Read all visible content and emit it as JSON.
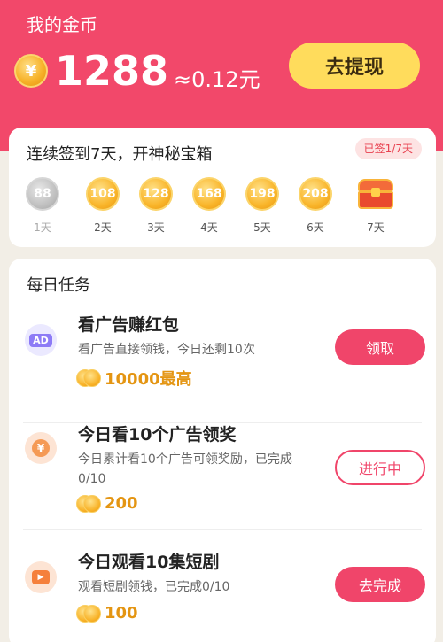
{
  "header": {
    "title": "我的金币",
    "coin_icon": "¥",
    "balance": "1288",
    "approx": "≈0.12元",
    "withdraw_label": "去提现"
  },
  "signin": {
    "title": "连续签到7天，开神秘宝箱",
    "badge": "已签1/7天",
    "days": [
      {
        "coins": "88",
        "label": "1天",
        "done": true
      },
      {
        "coins": "108",
        "label": "2天"
      },
      {
        "coins": "128",
        "label": "3天"
      },
      {
        "coins": "168",
        "label": "4天"
      },
      {
        "coins": "198",
        "label": "5天"
      },
      {
        "coins": "208",
        "label": "6天"
      },
      {
        "icon": "treasure-chest-icon",
        "label": "7天"
      }
    ]
  },
  "tasks": {
    "title": "每日任务",
    "items": [
      {
        "icon": "ad-icon",
        "icon_text": "AD",
        "name": "看广告赚红包",
        "desc": "看广告直接领钱，今日还剩10次",
        "reward": "10000最高",
        "button": "领取"
      },
      {
        "icon": "yen-coin-icon",
        "icon_text": "¥",
        "name": "今日看10个广告领奖",
        "desc": "今日累计看10个广告可领奖励，已完成0/10",
        "reward": "200",
        "button": "进行中"
      },
      {
        "icon": "play-video-icon",
        "icon_text": "▶",
        "name": "今日观看10集短剧",
        "desc": "观看短剧领钱，已完成0/10",
        "reward": "100",
        "button": "去完成"
      }
    ]
  },
  "colors": {
    "header_bg": "#f2486a",
    "withdraw_bg": "#ffdc5c",
    "accent": "#f0456a",
    "reward": "#e49512"
  }
}
